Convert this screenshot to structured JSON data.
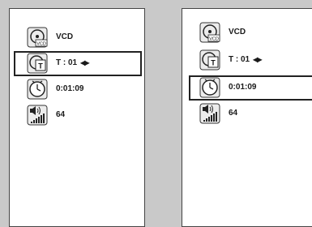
{
  "panels": [
    {
      "disc_type": "VCD",
      "track": "T : 01",
      "track_arrows": "◀▶",
      "time": "0:01:09",
      "volume": "64",
      "selected_row": "track"
    },
    {
      "disc_type": "VCD",
      "track": "T : 01",
      "track_arrows": "◀▶",
      "time": "0:01:09",
      "volume": "64",
      "selected_row": "time"
    }
  ],
  "icons": {
    "disc": "disc-icon",
    "track": "track-icon",
    "time": "clock-icon",
    "volume": "volume-icon"
  },
  "colors": {
    "background": "#c9c9c9",
    "panel": "#ffffff",
    "text": "#1a1a1a",
    "selection": "#222222"
  }
}
